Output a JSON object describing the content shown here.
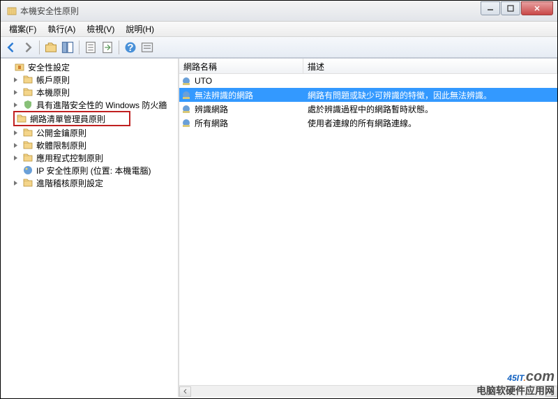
{
  "window": {
    "title": "本機安全性原則"
  },
  "menu": {
    "file": "檔案(F)",
    "action": "執行(A)",
    "view": "檢視(V)",
    "help": "說明(H)"
  },
  "tree": {
    "root": "安全性設定",
    "items": [
      "帳戶原則",
      "本機原則",
      "具有進階安全性的 Windows 防火牆",
      "網路清單管理員原則",
      "公開金鑰原則",
      "軟體限制原則",
      "應用程式控制原則",
      "IP 安全性原則 (位置: 本機電腦)",
      "進階稽核原則設定"
    ]
  },
  "list": {
    "columns": {
      "name": "網路名稱",
      "desc": "描述"
    },
    "rows": [
      {
        "name": "UTO",
        "desc": ""
      },
      {
        "name": "無法辨識的網路",
        "desc": "網路有問題或缺少可辨識的特徵，因此無法辨識。"
      },
      {
        "name": "辨識網路",
        "desc": "處於辨識過程中的網路暫時狀態。"
      },
      {
        "name": "所有網路",
        "desc": "使用者連線的所有網路連線。"
      }
    ]
  },
  "watermark": {
    "brand_45": "45",
    "brand_it": "IT",
    "brand_dot": ".",
    "brand_com": "com",
    "sub": "电脑软硬件应用网"
  }
}
